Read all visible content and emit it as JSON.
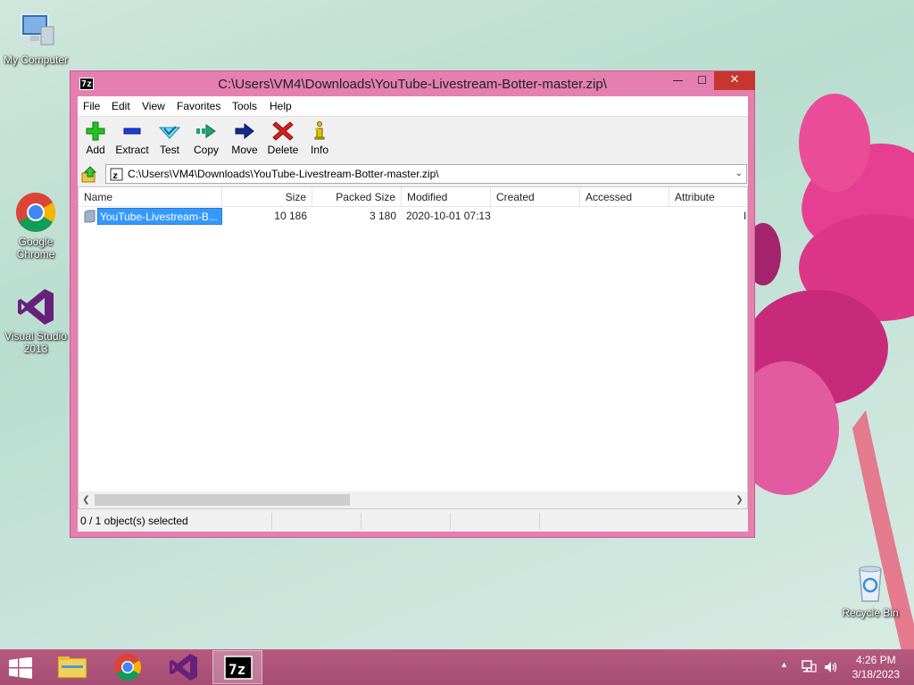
{
  "desktop": {
    "icons": [
      {
        "label": "My Computer"
      },
      {
        "label": "Google Chrome"
      },
      {
        "label": "Visual Studio 2013"
      },
      {
        "label": "Recycle Bin"
      }
    ]
  },
  "window": {
    "app_icon_label": "7z",
    "title": "C:\\Users\\VM4\\Downloads\\YouTube-Livestream-Botter-master.zip\\",
    "minimize_glyph": "—",
    "maximize_glyph": "☐",
    "close_glyph": "✕",
    "menu": [
      "File",
      "Edit",
      "View",
      "Favorites",
      "Tools",
      "Help"
    ],
    "toolbar": [
      {
        "label": "Add",
        "icon": "plus-icon"
      },
      {
        "label": "Extract",
        "icon": "minus-icon"
      },
      {
        "label": "Test",
        "icon": "check-icon"
      },
      {
        "label": "Copy",
        "icon": "double-arrow-icon"
      },
      {
        "label": "Move",
        "icon": "arrow-right-icon"
      },
      {
        "label": "Delete",
        "icon": "x-icon"
      },
      {
        "label": "Info",
        "icon": "info-icon"
      }
    ],
    "address": "C:\\Users\\VM4\\Downloads\\YouTube-Livestream-Botter-master.zip\\",
    "columns": [
      "Name",
      "Size",
      "Packed Size",
      "Modified",
      "Created",
      "Accessed",
      "Attribute"
    ],
    "rows": [
      {
        "name": "YouTube-Livestream-B...",
        "size": "10 186",
        "packed": "3 180",
        "modified": "2020-10-01 07:13",
        "created": "",
        "accessed": "",
        "attributes": "I"
      }
    ],
    "status": "0 / 1 object(s) selected"
  },
  "taskbar": {
    "clock_time": "4:26 PM",
    "clock_date": "3/18/2023",
    "tray_arrow": "▲"
  },
  "colors": {
    "window_frame": "#e47fb0",
    "close_button": "#c7362e",
    "taskbar": "#a64d73",
    "selection": "#3399ff"
  }
}
